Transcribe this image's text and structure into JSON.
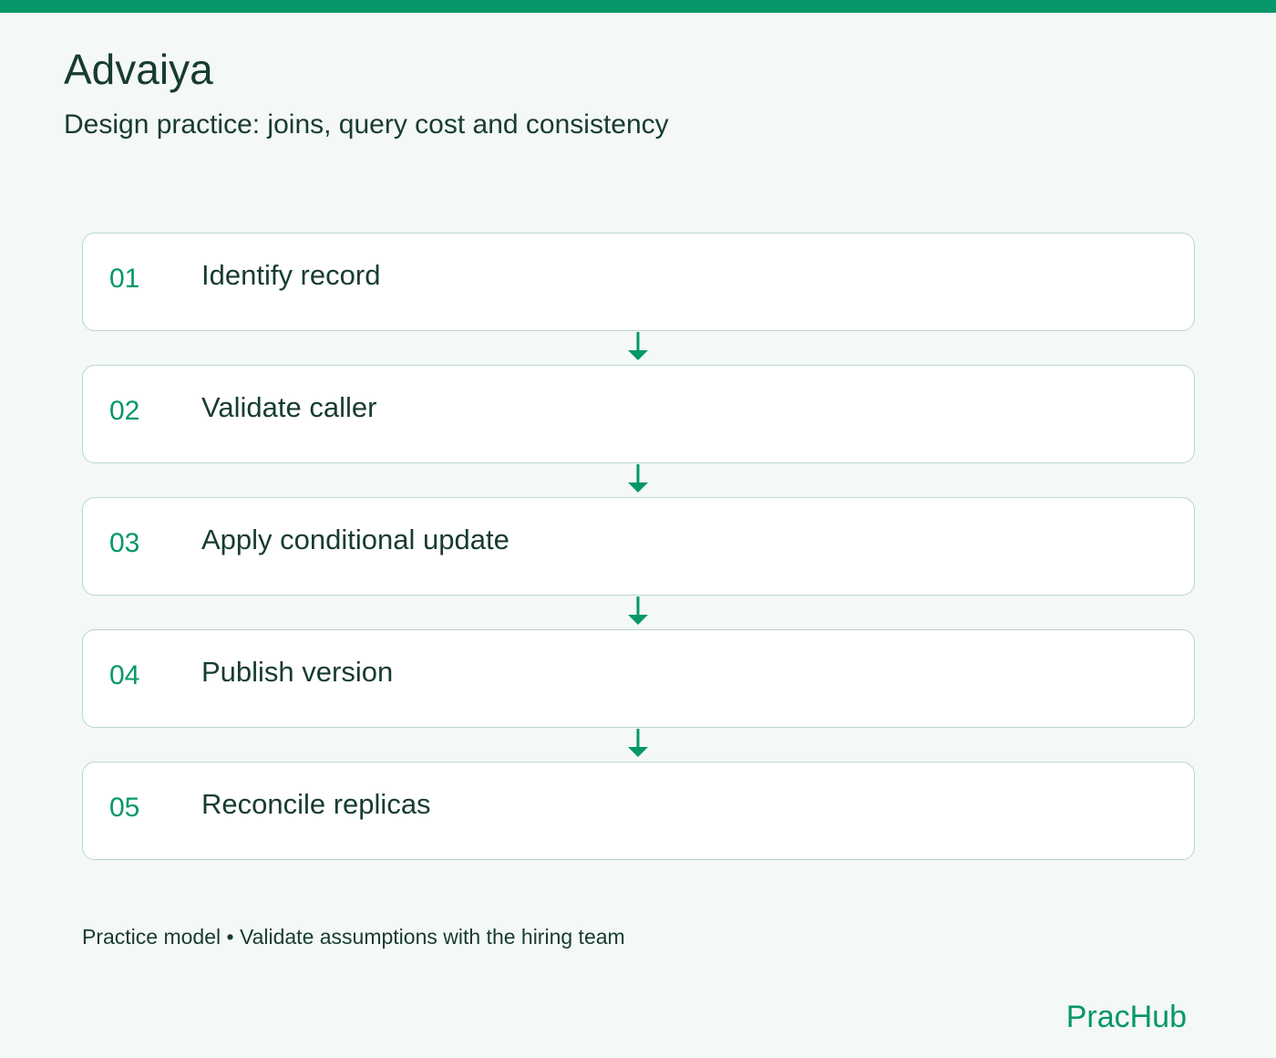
{
  "header": {
    "title": "Advaiya",
    "subtitle": "Design practice: joins, query cost and consistency"
  },
  "steps": [
    {
      "number": "01",
      "label": "Identify record"
    },
    {
      "number": "02",
      "label": "Validate caller"
    },
    {
      "number": "03",
      "label": "Apply conditional update"
    },
    {
      "number": "04",
      "label": "Publish version"
    },
    {
      "number": "05",
      "label": "Reconcile replicas"
    }
  ],
  "footer": {
    "note": "Practice model • Validate assumptions with the hiring team",
    "brand": "PracHub"
  },
  "colors": {
    "accent": "#05976a",
    "text": "#173b33",
    "background": "#f4f8f6",
    "card_border": "#b7d8cd",
    "card_background": "#ffffff"
  },
  "icons": {
    "connector": "arrow-down-icon"
  }
}
